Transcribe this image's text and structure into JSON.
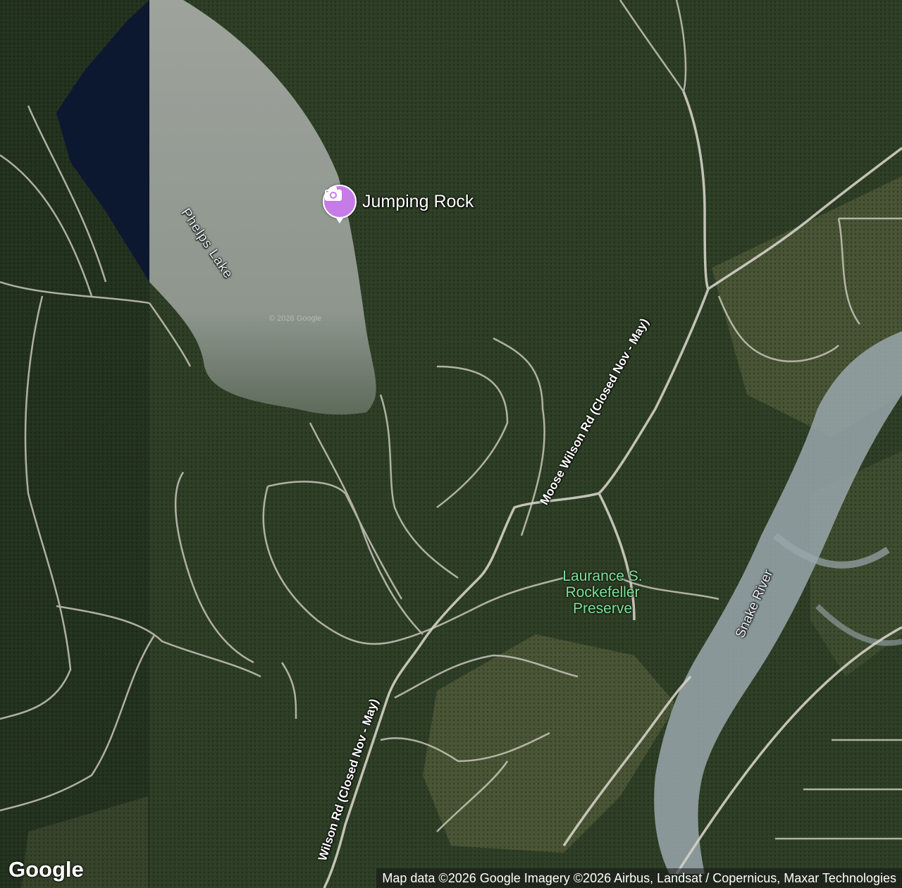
{
  "map": {
    "type": "satellite",
    "colors": {
      "forest": "#2e3e26",
      "forest_dark": "#1f2c1c",
      "meadow": "#5c6440",
      "lake": "#0c1830",
      "lake_glare": "#a8aea6",
      "river": "#9aa7ad",
      "road": "#c9c6bc",
      "preserve_label": "#7ee39a",
      "poi": "#c67be8"
    }
  },
  "labels": {
    "lake": "Phelps Lake",
    "road_upper": "Moose Wilson Rd (Closed Nov - May)",
    "road_lower": "Wilson Rd (Closed Nov - May)",
    "river": "Snake River",
    "preserve": "Laurance S. Rockefeller Preserve"
  },
  "poi": {
    "name": "Jumping Rock",
    "icon": "camera-icon"
  },
  "watermark": "© 2026 Google",
  "branding": {
    "logo": "Google",
    "attribution": "Map data ©2026 Google Imagery ©2026 Airbus, Landsat / Copernicus, Maxar Technologies"
  }
}
